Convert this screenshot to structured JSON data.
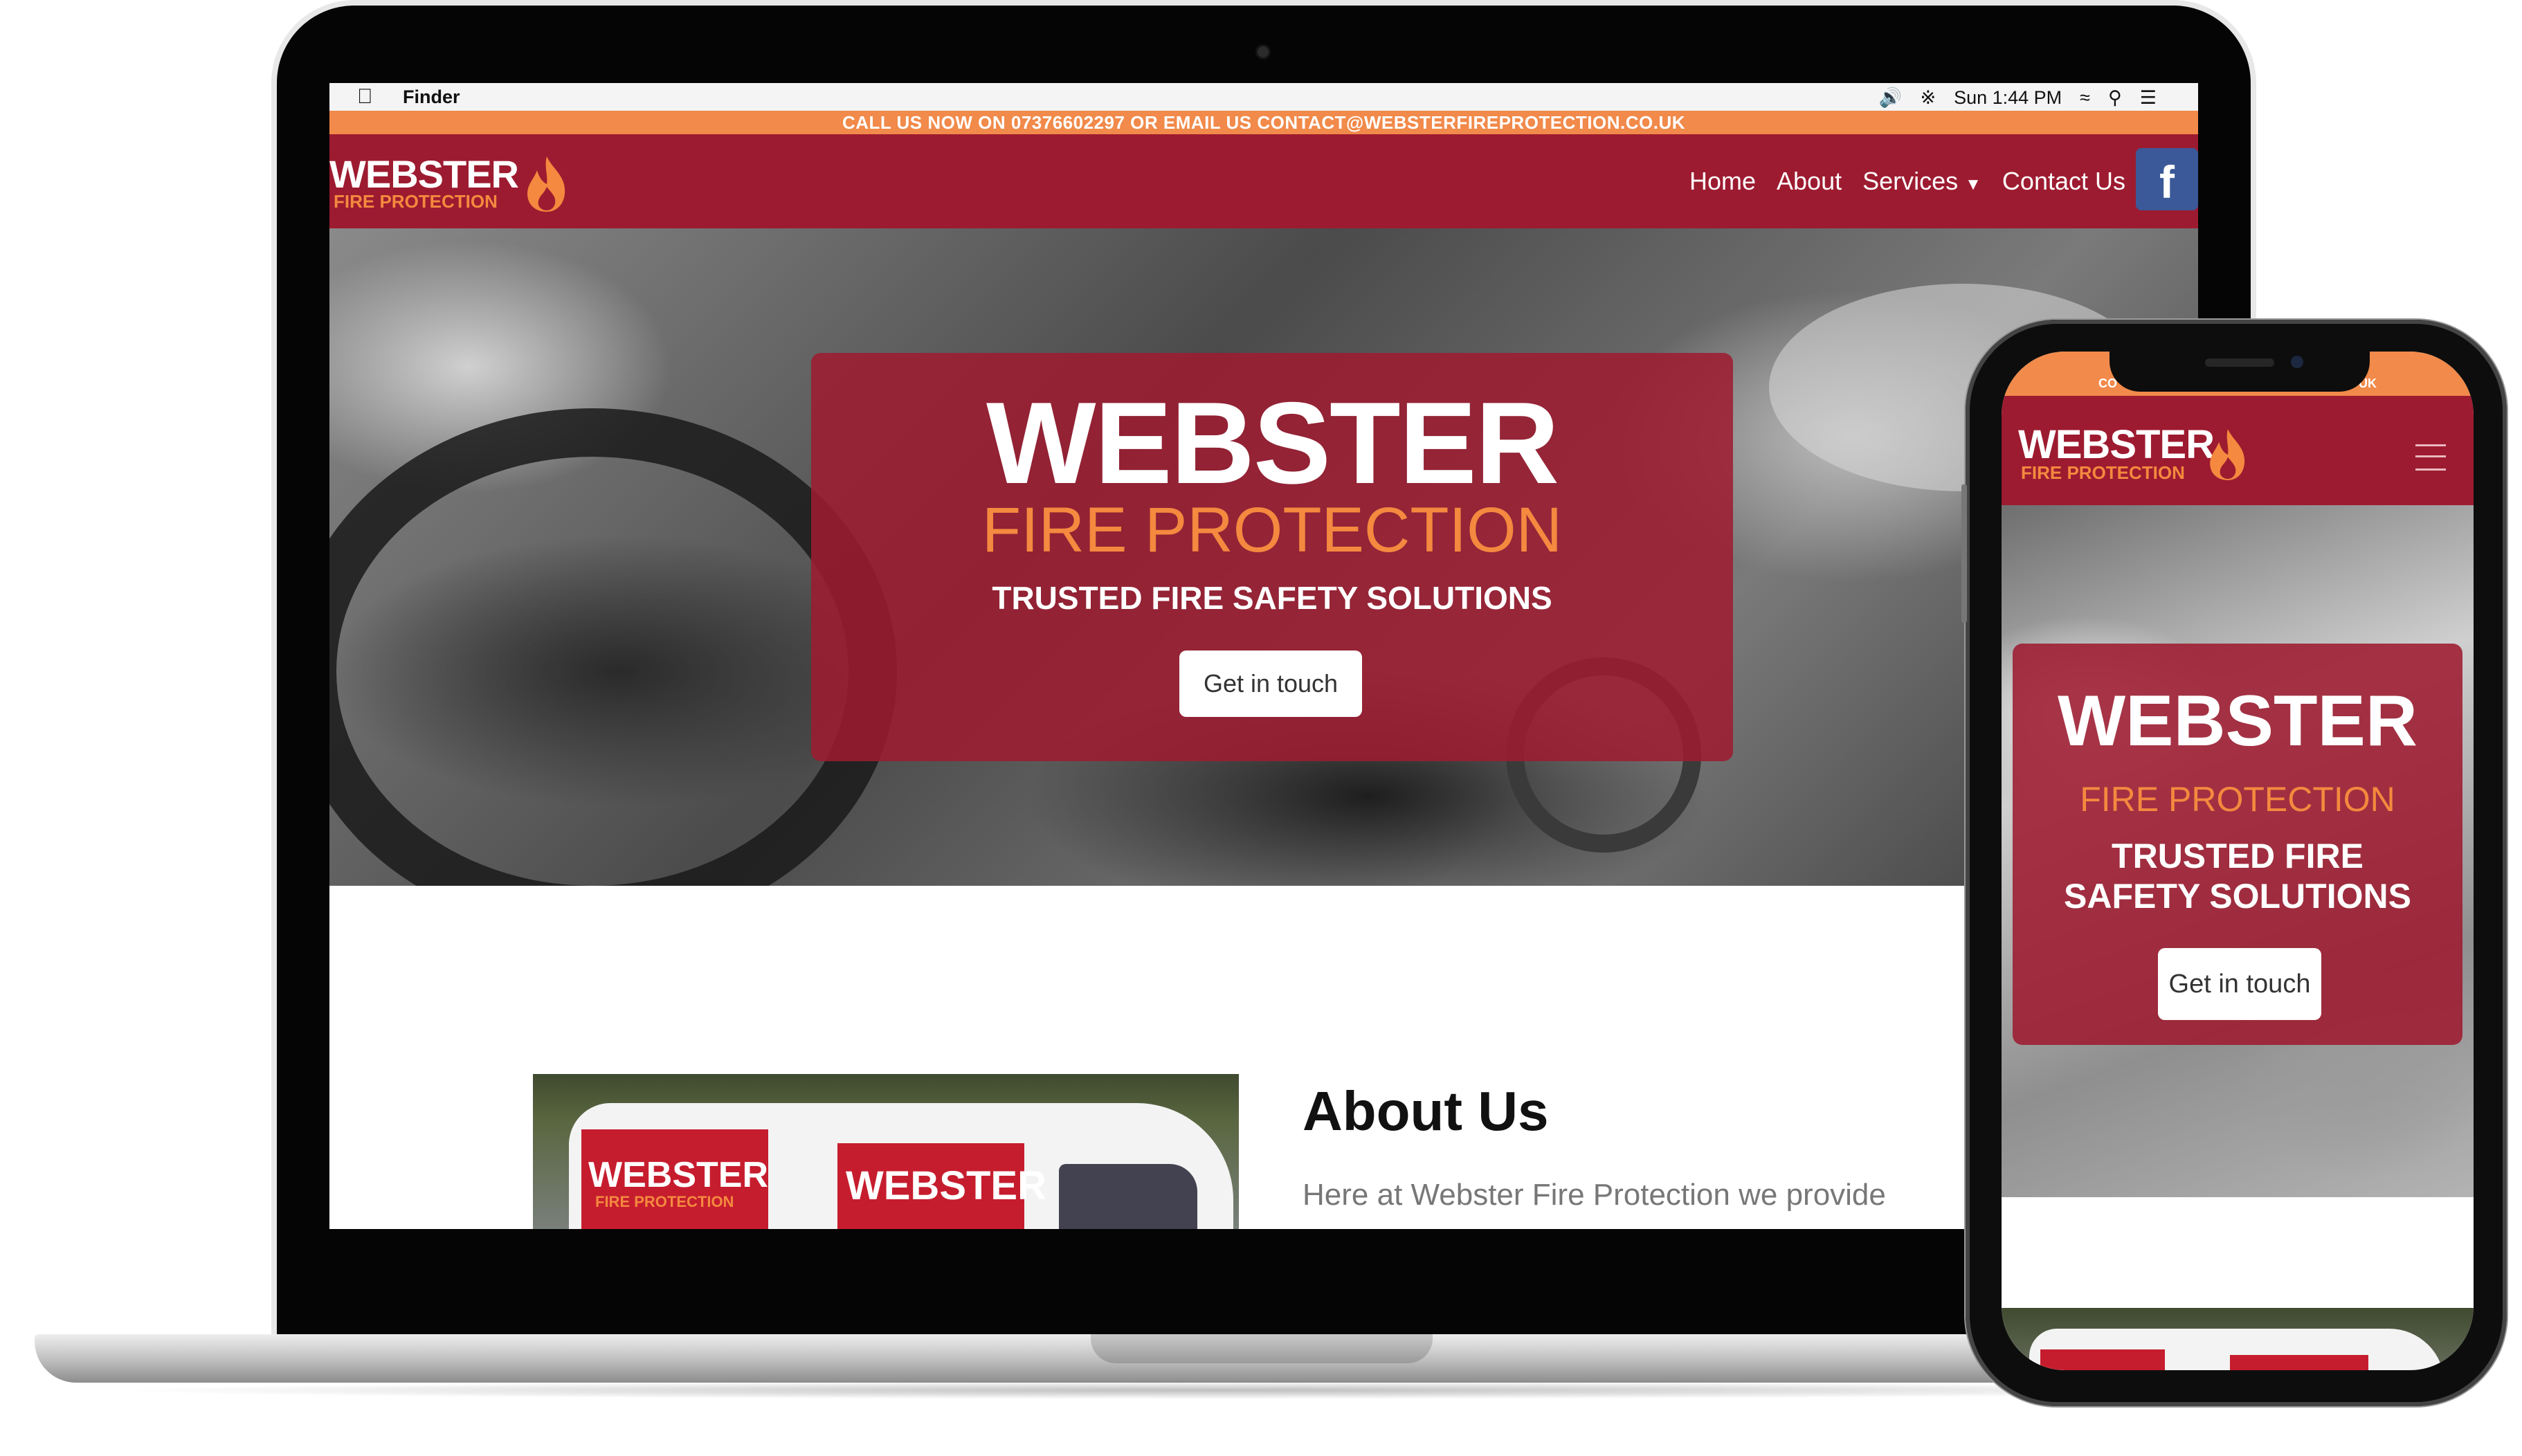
{
  "menubar": {
    "app": "Finder",
    "clock": "Sun 1:44 PM"
  },
  "topstrip": "CALL US NOW ON 07376602297 OR EMAIL US CONTACT@WEBSTERFIREPROTECTION.CO.UK",
  "logo": {
    "main": "WEBSTER",
    "sub": "FIRE PROTECTION"
  },
  "nav": {
    "items": [
      "Home",
      "About",
      "Services",
      "Contact Us"
    ],
    "facebook": "f"
  },
  "hero": {
    "title": "WEBSTER",
    "subtitle": "FIRE PROTECTION",
    "tagline": "TRUSTED FIRE SAFETY SOLUTIONS",
    "button": "Get in touch"
  },
  "about": {
    "title": "About Us",
    "intro": "Here at Webster Fire Protection we provide"
  },
  "van": {
    "text_main": "WEBSTER",
    "text_sub": "FIRE PROTECTION"
  },
  "phone": {
    "strip_left": "CO",
    "strip_right": "UK",
    "logo_main": "WEBSTER",
    "logo_sub": "FIRE PROTECTION",
    "hero_title": "WEBSTER",
    "hero_subtitle": "FIRE PROTECTION",
    "hero_tagline": "TRUSTED FIRE SAFETY SOLUTIONS",
    "hero_button": "Get in touch"
  },
  "colors": {
    "brand_red": "#9d1b30",
    "accent_orange": "#f18a4a",
    "facebook_blue": "#3b5998"
  }
}
